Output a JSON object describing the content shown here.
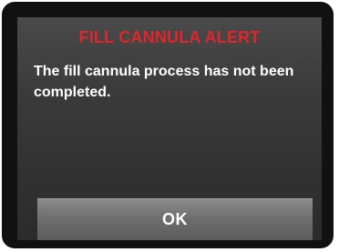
{
  "alert": {
    "title": "FILL CANNULA ALERT",
    "message": "The fill cannula process has not been completed.",
    "ok_label": "OK"
  },
  "colors": {
    "title": "#e0262c",
    "message": "#ffffff",
    "screen_background": "#3a3a3a",
    "button": "#6f6f6f",
    "frame": "#111111"
  }
}
